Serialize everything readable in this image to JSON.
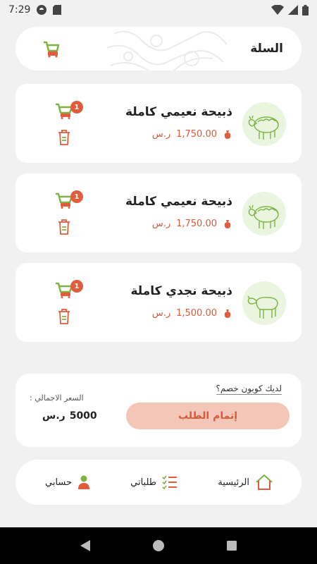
{
  "status_bar": {
    "time": "7:29"
  },
  "header": {
    "title": "السلة",
    "cart_icon": "cart-icon"
  },
  "cart_items": [
    {
      "name": "ذبيحة نعيمي كاملة",
      "price": "1,750.00",
      "currency": "ر.س",
      "quantity": "1"
    },
    {
      "name": "ذبيحة نعيمي كاملة",
      "price": "1,750.00",
      "currency": "ر.س",
      "quantity": "1"
    },
    {
      "name": "ذبيحة نجدي كاملة",
      "price": "1,500.00",
      "currency": "ر.س",
      "quantity": "1"
    }
  ],
  "summary": {
    "coupon_link": "لديك كوبون خصم؟",
    "checkout_button": "إتمام الطلب",
    "total_label": "السعر الاجمالي :",
    "total_value": "5000",
    "total_currency": "ر.س"
  },
  "bottom_nav": {
    "home": "الرئيسية",
    "orders": "طلباتي",
    "account": "حسابي"
  },
  "colors": {
    "accent": "#e05c3c",
    "green": "#7cb342",
    "checkout_bg": "#f3c6b8"
  }
}
